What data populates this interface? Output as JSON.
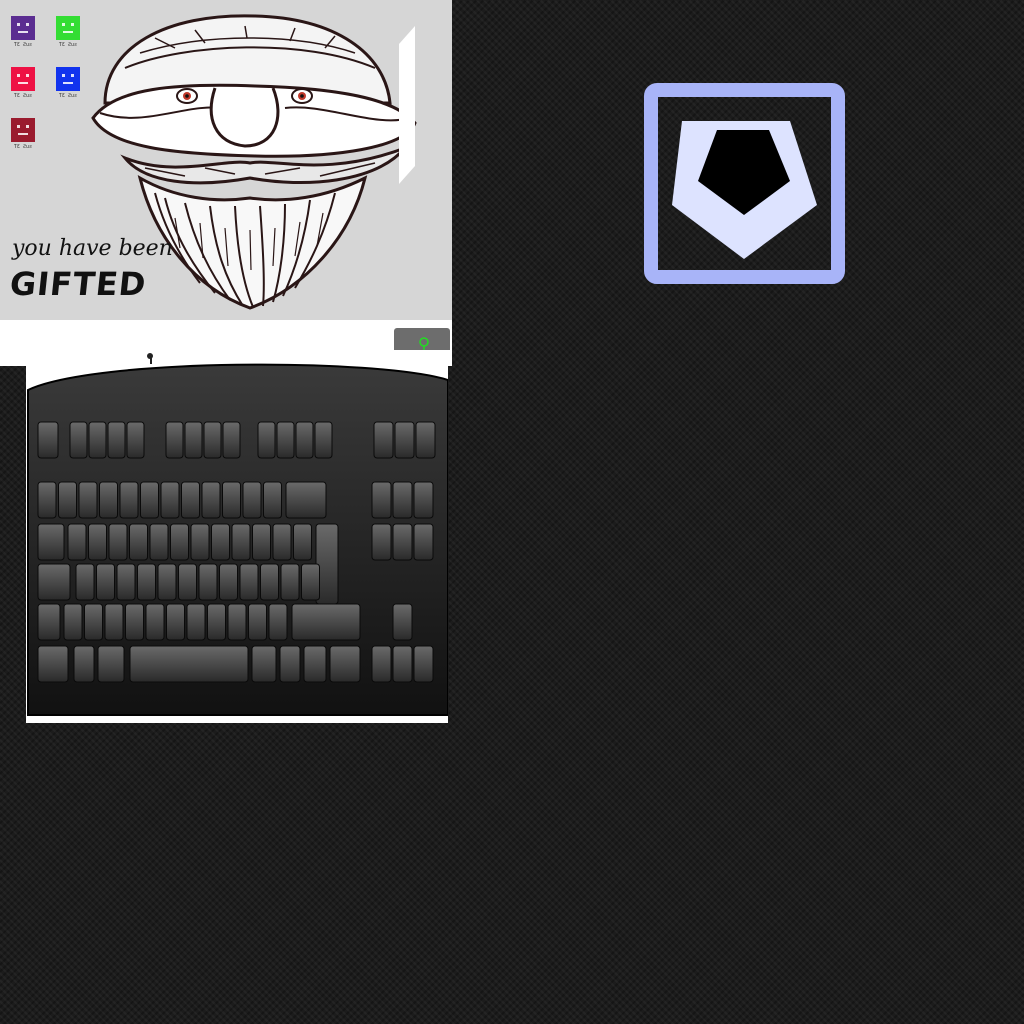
{
  "desktop": {
    "icons": [
      {
        "name": "icon-purple",
        "color": "#5b2d91",
        "label": "ƬƐ Ƨuƨ"
      },
      {
        "name": "icon-green",
        "color": "#33dd33",
        "label": "ƬƐ Ƨuƨ"
      },
      {
        "name": "icon-red",
        "color": "#ee1144",
        "label": "ƬƐ Ƨuƨ"
      },
      {
        "name": "icon-blue",
        "color": "#1133ee",
        "label": "ƬƐ Ƨuƨ"
      },
      {
        "name": "icon-crimson",
        "color": "#9a1b2e",
        "label": "ƬƐ Ƨuƨ"
      }
    ]
  },
  "gift_card": {
    "line1": "you have been",
    "line2": "GIFTED"
  },
  "colors": {
    "shield_outline": "#a8b4f8",
    "shield_fill": "#dde3ff",
    "toolbar_icon": "#22dd22"
  },
  "icons": {
    "toolbar": "pin-icon",
    "logo": "pentagon-shield-icon"
  }
}
